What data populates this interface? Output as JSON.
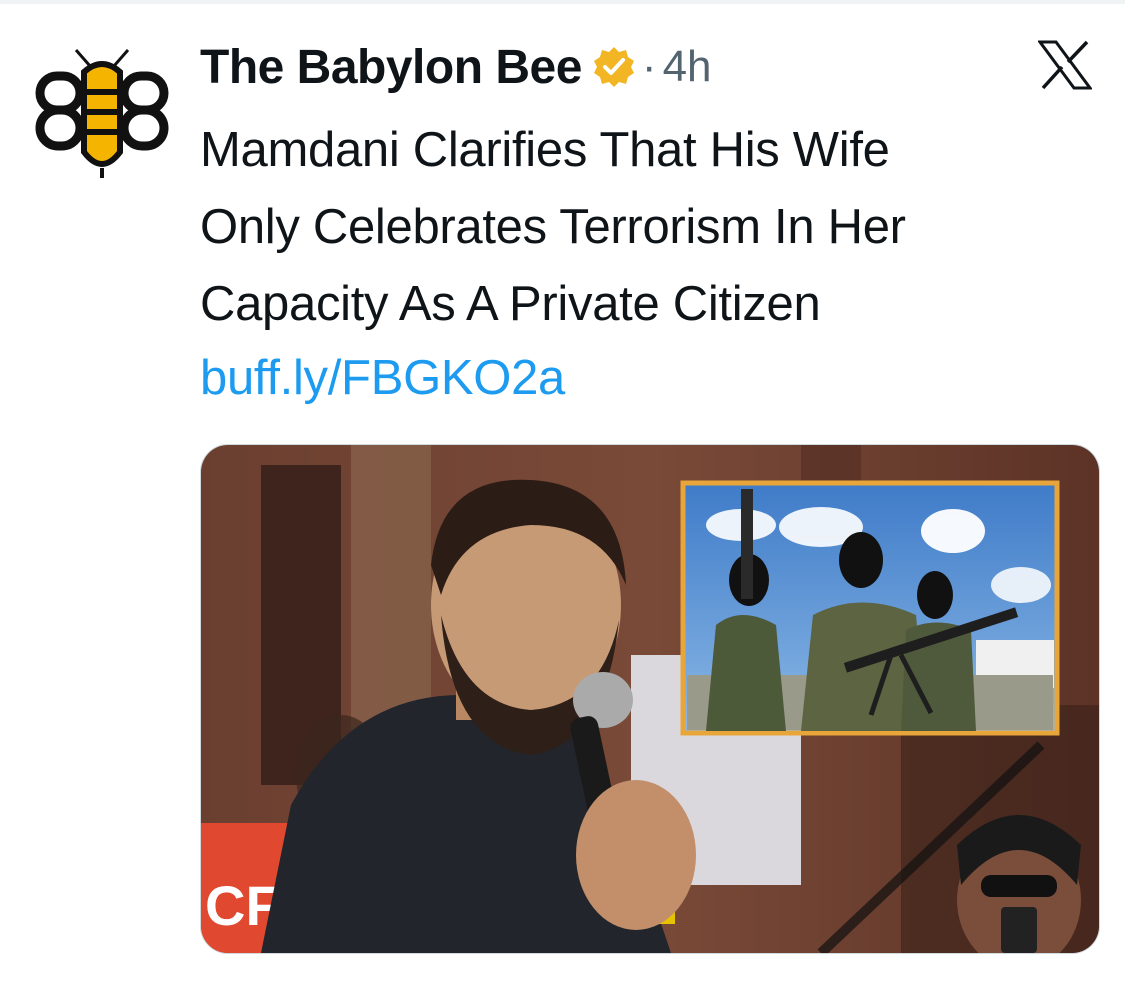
{
  "tweet": {
    "author": {
      "display_name": "The Babylon Bee",
      "verified_icon": "gold-verified-badge",
      "avatar_icon": "babylon-bee-logo"
    },
    "separator": "·",
    "time": "4h",
    "platform_icon": "x-logo",
    "text_lines": [
      "Mamdani Clarifies That His Wife",
      "Only Celebrates Terrorism In Her",
      "Capacity As A Private Citizen"
    ],
    "link": "buff.ly/FBGKO2a",
    "media": {
      "description_icon": "news-photo",
      "sign_text": "CF",
      "inset_border_color": "#e8a63a"
    }
  },
  "colors": {
    "link": "#1d9bf0",
    "text": "#0f1419",
    "muted": "#536471",
    "bee_yellow": "#f4b400",
    "verified_gold": "#f2b624"
  }
}
